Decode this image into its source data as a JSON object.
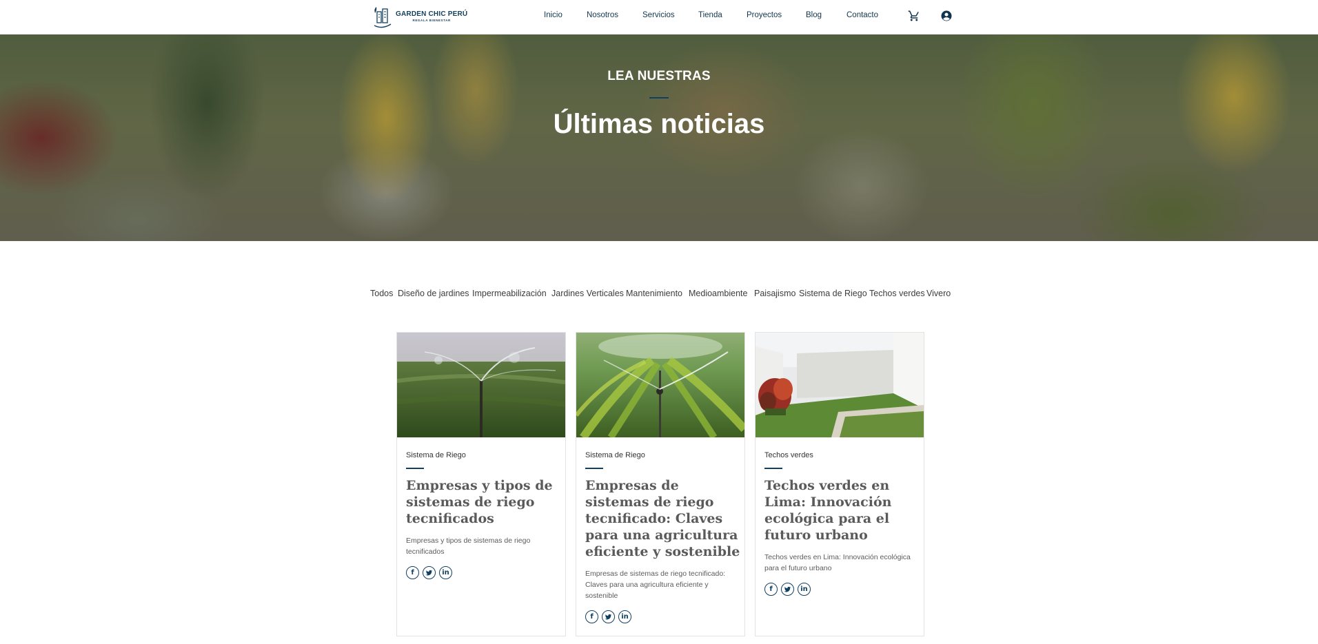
{
  "brand": {
    "name": "GARDEN CHIC PERÚ",
    "tagline": "REGALA BIENESTAR"
  },
  "nav": {
    "items": [
      "Inicio",
      "Nosotros",
      "Servicios",
      "Tienda",
      "Proyectos",
      "Blog",
      "Contacto"
    ],
    "icons": [
      "cart-icon",
      "account-icon"
    ]
  },
  "hero": {
    "kicker": "LEA NUESTRAS",
    "title": "Últimas noticias"
  },
  "filters": [
    "Todos",
    "Diseño de jardines",
    "Impermeabilización",
    "Jardines Verticales",
    "Mantenimiento",
    "Medioambiente",
    "Paisajismo",
    "Sistema de Riego",
    "Techos verdes",
    "Vivero"
  ],
  "posts": [
    {
      "category": "Sistema de Riego",
      "title": "Empresas y tipos de sistemas de riego tecnificados",
      "excerpt": "Empresas y tipos de sistemas de riego tecnificados",
      "share": [
        "facebook-icon",
        "twitter-icon",
        "linkedin-icon"
      ]
    },
    {
      "category": "Sistema de Riego",
      "title": "Empresas de sistemas de riego tecnificado: Claves para una agricultura eficiente y sostenible",
      "excerpt": "Empresas de sistemas de riego tecnificado: Claves para una agricultura eficiente y sostenible",
      "share": [
        "facebook-icon",
        "twitter-icon",
        "linkedin-icon"
      ]
    },
    {
      "category": "Techos verdes",
      "title": "Techos verdes en Lima: Innovación ecológica para el futuro urbano",
      "excerpt": "Techos verdes en Lima: Innovación ecológica para el futuro urbano",
      "share": [
        "facebook-icon",
        "twitter-icon",
        "linkedin-icon"
      ]
    }
  ],
  "colors": {
    "accent": "#0f3f61",
    "nav_text": "#11354f",
    "title_gray": "#5a5a5a"
  }
}
